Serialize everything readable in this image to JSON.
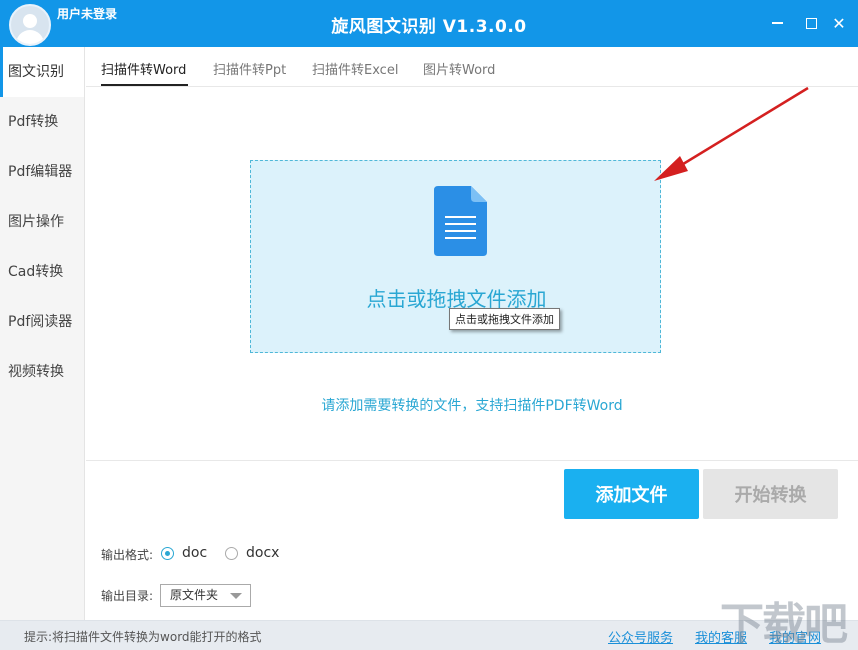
{
  "window": {
    "title": "旋风图文识别 V1.3.0.0",
    "user_status": "用户未登录",
    "close_glyph": "✕"
  },
  "sidebar": {
    "items": [
      {
        "label": "图文识别",
        "active": true
      },
      {
        "label": "Pdf转换"
      },
      {
        "label": "Pdf编辑器"
      },
      {
        "label": "图片操作"
      },
      {
        "label": "Cad转换"
      },
      {
        "label": "Pdf阅读器"
      },
      {
        "label": "视频转换"
      }
    ]
  },
  "tabs": [
    {
      "label": "扫描件转Word",
      "active": true
    },
    {
      "label": "扫描件转Ppt"
    },
    {
      "label": "扫描件转Excel"
    },
    {
      "label": "图片转Word"
    }
  ],
  "dropzone": {
    "label": "点击或拖拽文件添加",
    "tooltip": "点击或拖拽文件添加",
    "icon": "document-icon"
  },
  "hint": "请添加需要转换的文件，支持扫描件PDF转Word",
  "actions": {
    "add_file": "添加文件",
    "start_convert": "开始转换"
  },
  "output": {
    "format_label": "输出格式:",
    "formats": [
      {
        "label": "doc",
        "checked": true
      },
      {
        "label": "docx",
        "checked": false
      }
    ],
    "dir_label": "输出目录:",
    "dir_value": "原文件夹"
  },
  "statusbar": {
    "tip": "提示:将扫描件文件转换为word能打开的格式",
    "links": [
      "公众号服务",
      "我的客服",
      "我的官网"
    ]
  },
  "watermark": "下载吧",
  "colors": {
    "accent": "#1296e8",
    "dropzone_bg": "#dcf2fb",
    "link": "#1a8fd8",
    "annotation_arrow": "#d42020"
  }
}
